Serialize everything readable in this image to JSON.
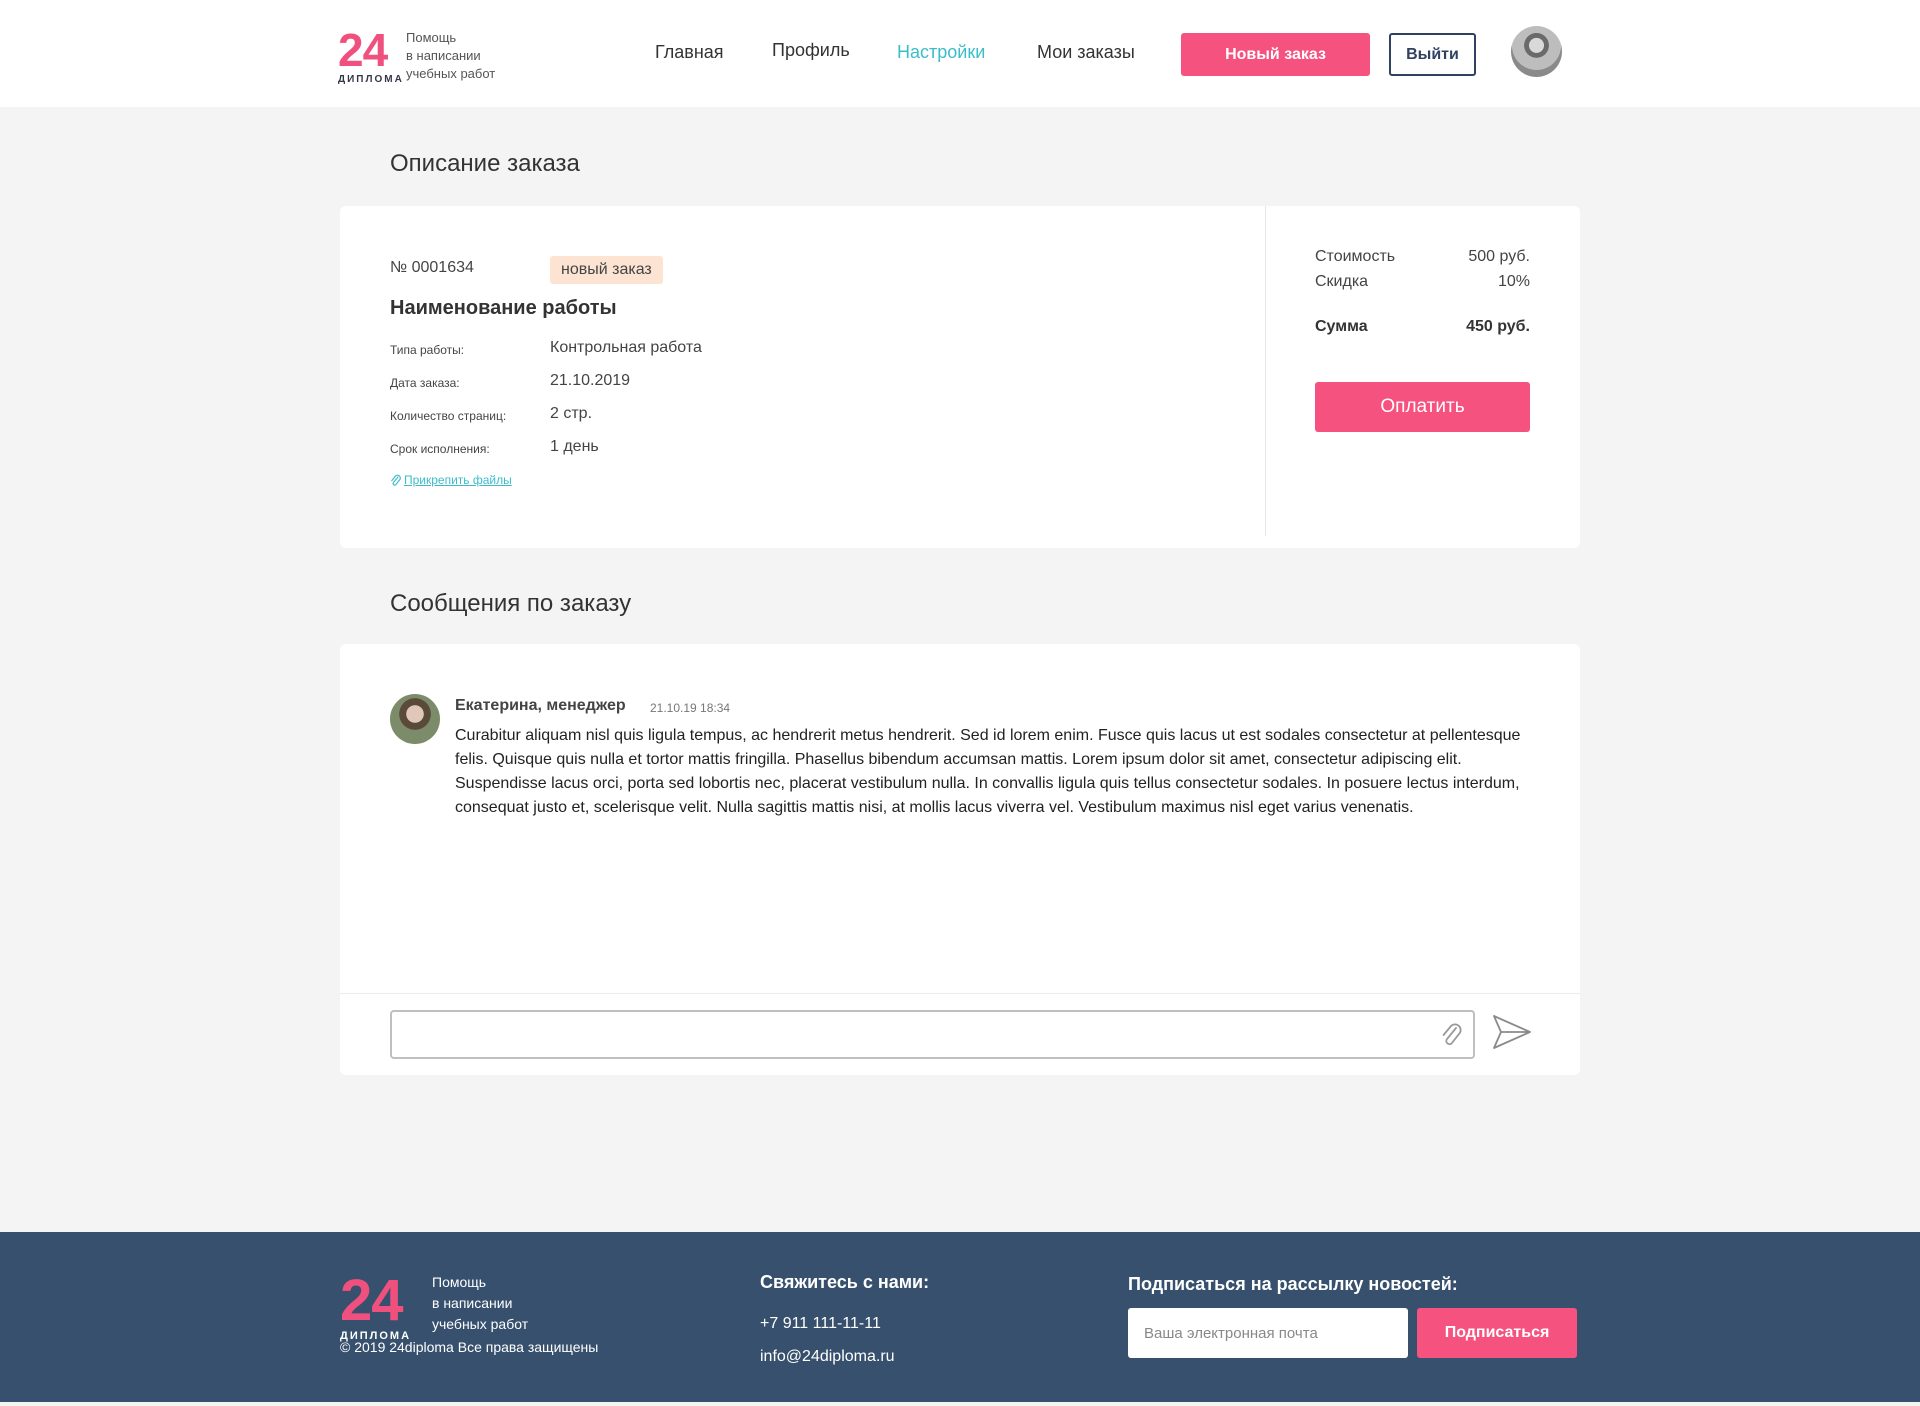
{
  "brand": {
    "number": "24",
    "word": "ДИПЛОМА",
    "tagline": [
      "Помощь",
      "в написании",
      "учебных работ"
    ]
  },
  "nav": {
    "items": [
      "Главная",
      "Профиль",
      "Настройки",
      "Мои заказы"
    ],
    "active_index": 2,
    "new_order_label": "Новый заказ",
    "logout_label": "Выйти"
  },
  "order": {
    "section_title": "Описание заказа",
    "number": "№ 0001634",
    "status": "новый заказ",
    "title": "Наименование работы",
    "props": [
      {
        "label": "Типа работы:",
        "value": "Контрольная работа"
      },
      {
        "label": "Дата заказа:",
        "value": "21.10.2019"
      },
      {
        "label": "Количество страниц:",
        "value": "2 стр."
      },
      {
        "label": "Срок исполнения:",
        "value": "1 день"
      }
    ],
    "attach_label": "Прикрепить файлы",
    "price": {
      "cost_label": "Стоимость",
      "cost_value": "500 руб.",
      "discount_label": "Скидка",
      "discount_value": "10%",
      "total_label": "Сумма",
      "total_value": "450 руб."
    },
    "pay_label": "Оплатить"
  },
  "messages": {
    "section_title": "Сообщения по заказу",
    "items": [
      {
        "author": "Екатерина, менеджер",
        "time": "21.10.19  18:34",
        "text": "Curabitur aliquam nisl quis ligula tempus, ac hendrerit metus hendrerit. Sed id lorem enim. Fusce quis lacus ut est sodales consectetur at pellentesque felis. Quisque quis nulla et tortor mattis fringilla. Phasellus bibendum accumsan mattis. Lorem ipsum dolor sit amet, consectetur adipiscing elit. Suspendisse lacus orci, porta sed lobortis nec, placerat vestibulum nulla. In convallis ligula quis tellus consectetur sodales. In posuere lectus interdum, consequat justo et, scelerisque velit. Nulla sagittis mattis nisi, at mollis lacus viverra vel. Vestibulum maximus nisl eget varius venenatis."
      }
    ],
    "input_value": ""
  },
  "footer": {
    "copyright": "© 2019 24diploma Все права защищены",
    "contact_title": "Свяжитесь с нами:",
    "phone": "+7 911 111-11-11",
    "email": "info@24diploma.ru",
    "subscribe_title": "Подписаться на рассылку новостей:",
    "subscribe_placeholder": "Ваша электронная почта",
    "subscribe_button": "Подписаться"
  },
  "colors": {
    "accent": "#f6527f",
    "active_nav": "#3bbdc9",
    "footer_bg": "#36506d",
    "badge_bg": "#fde3d2"
  }
}
